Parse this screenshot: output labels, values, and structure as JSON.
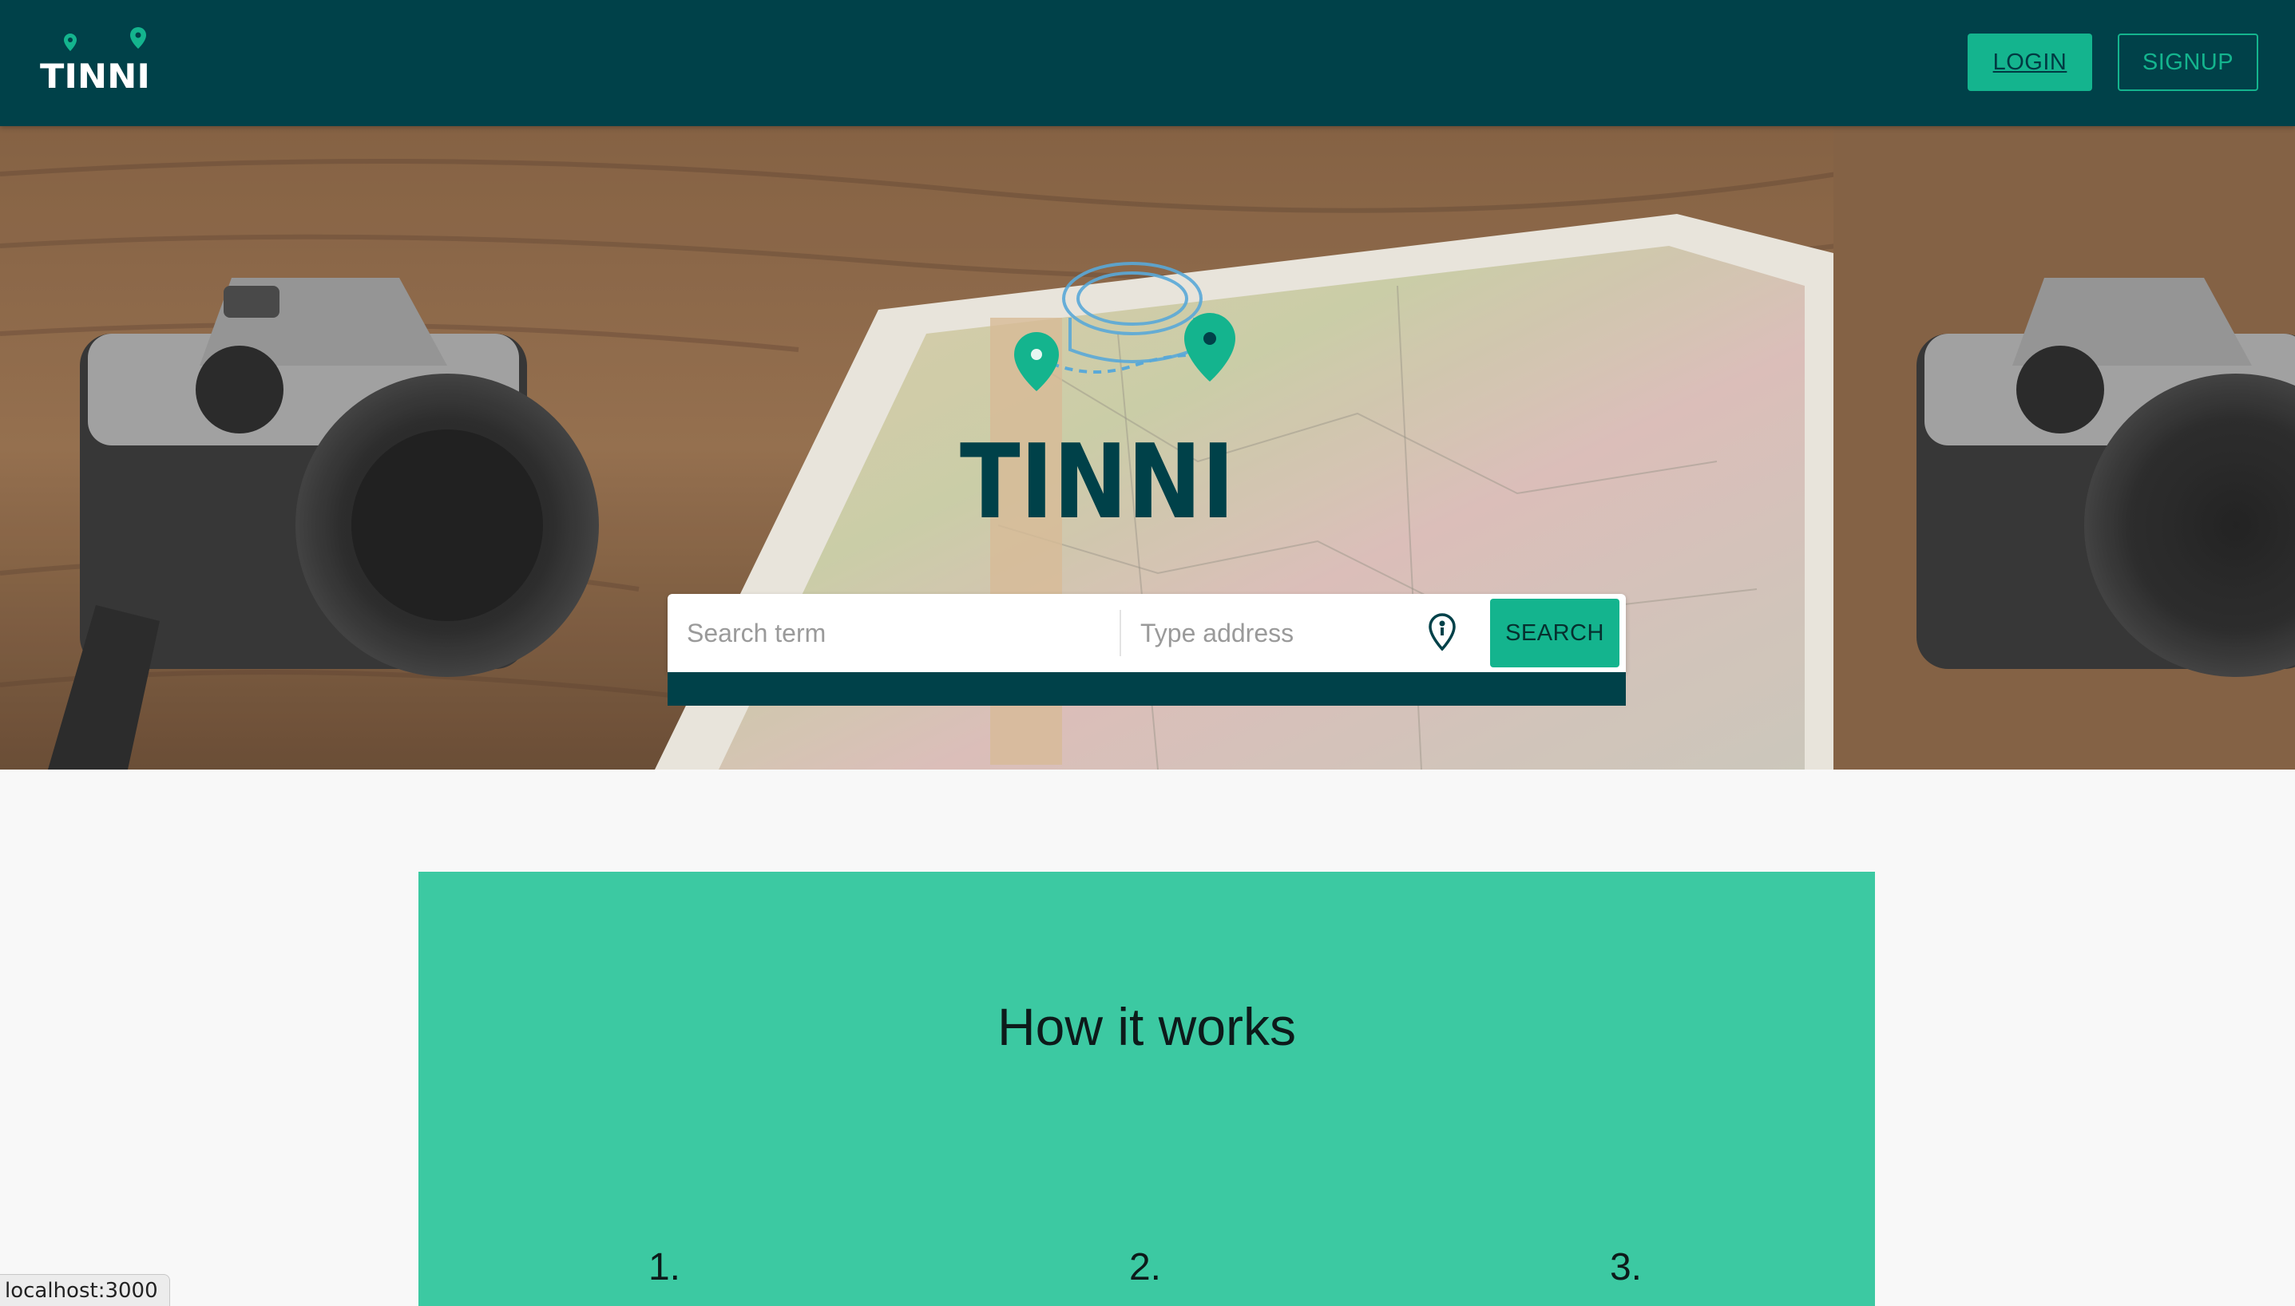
{
  "brand": {
    "name": "TINNI",
    "colors": {
      "navbar": "#004149",
      "accent": "#14b48e",
      "panel": "#3cc9a2"
    }
  },
  "navbar": {
    "login_label": "LOGIN",
    "signup_label": "SIGNUP"
  },
  "hero": {
    "logo_text": "TINNI",
    "background_icon": "camera-and-map-photo",
    "search": {
      "term_placeholder": "Search term",
      "address_placeholder": "Type address",
      "location_icon": "map-pin-icon",
      "button_label": "SEARCH"
    }
  },
  "how_it_works": {
    "title": "How it works",
    "steps": [
      "1.",
      "2.",
      "3."
    ]
  },
  "status_bar": {
    "url": "localhost:3000"
  }
}
